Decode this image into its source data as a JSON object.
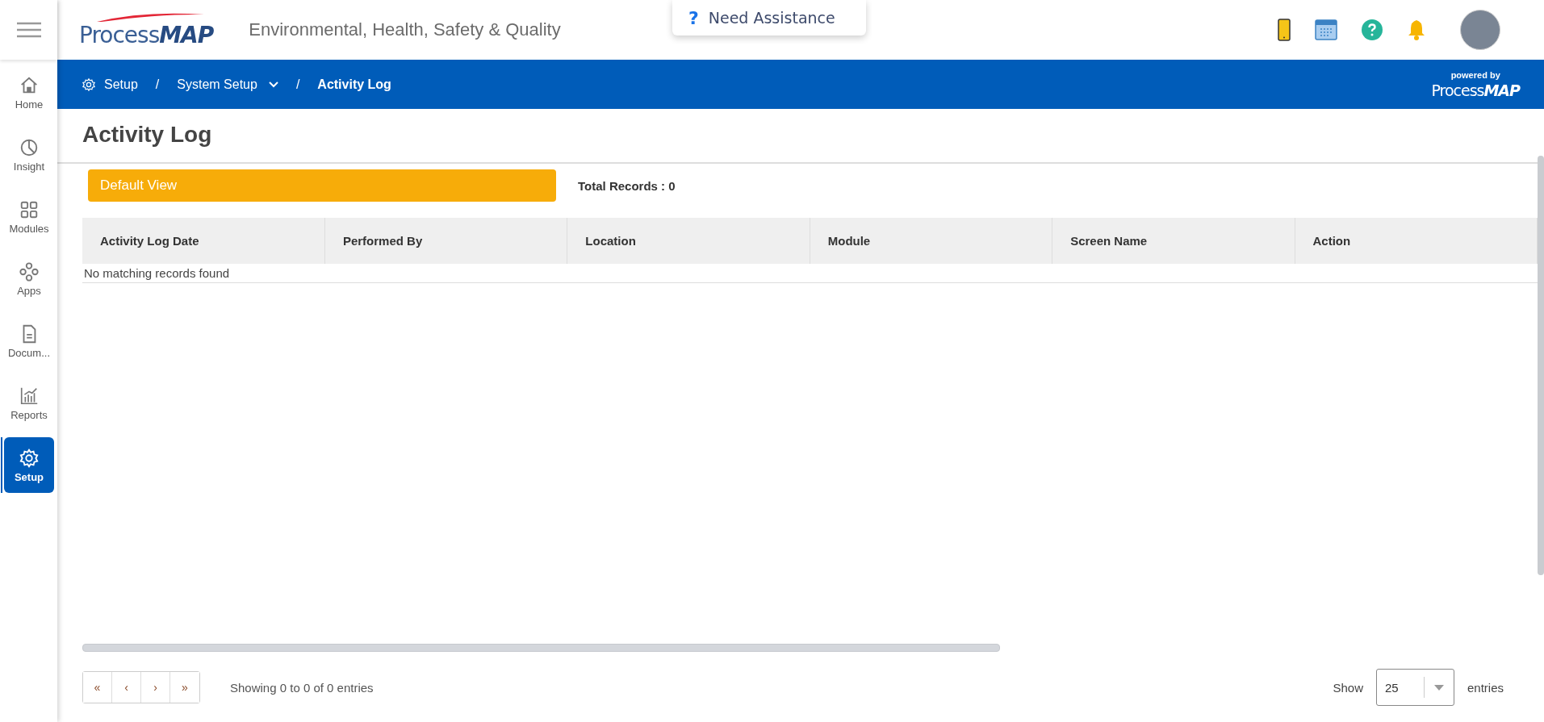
{
  "header": {
    "logo": "Process",
    "logo_bold": "MAP",
    "subtitle": "Environmental, Health, Safety & Quality",
    "assistance": {
      "icon": "?",
      "label": "Need Assistance"
    }
  },
  "sidebar": {
    "items": [
      {
        "label": "Home",
        "kind": "home",
        "selected": false
      },
      {
        "label": "Insight",
        "kind": "pie",
        "selected": false
      },
      {
        "label": "Modules",
        "kind": "grid",
        "selected": false
      },
      {
        "label": "Apps",
        "kind": "apps",
        "selected": false
      },
      {
        "label": "Docum...",
        "kind": "doc",
        "selected": false
      },
      {
        "label": "Reports",
        "kind": "chart",
        "selected": false
      },
      {
        "label": "Setup",
        "kind": "gear",
        "selected": true
      }
    ]
  },
  "breadcrumb": {
    "separator": "/",
    "items": [
      {
        "label": "Setup",
        "kind": "gear"
      },
      {
        "label": "System Setup",
        "kind": "dropdown"
      },
      {
        "label": "Activity Log",
        "kind": "current"
      }
    ],
    "powered_by": "powered by",
    "logo": "Process",
    "logo_bold": "MAP"
  },
  "page": {
    "title": "Activity Log",
    "view": "Default View",
    "total": "Total Records : 0",
    "table": {
      "columns": [
        "Activity Log Date",
        "Performed By",
        "Location",
        "Module",
        "Screen Name",
        "Action"
      ],
      "empty": "No matching records found"
    },
    "pager": {
      "buttons": [
        "«",
        "‹",
        "›",
        "»"
      ],
      "info": "Showing 0 to 0 of 0 entries",
      "show": "Show",
      "page_size": "25",
      "entries": "entries"
    }
  }
}
